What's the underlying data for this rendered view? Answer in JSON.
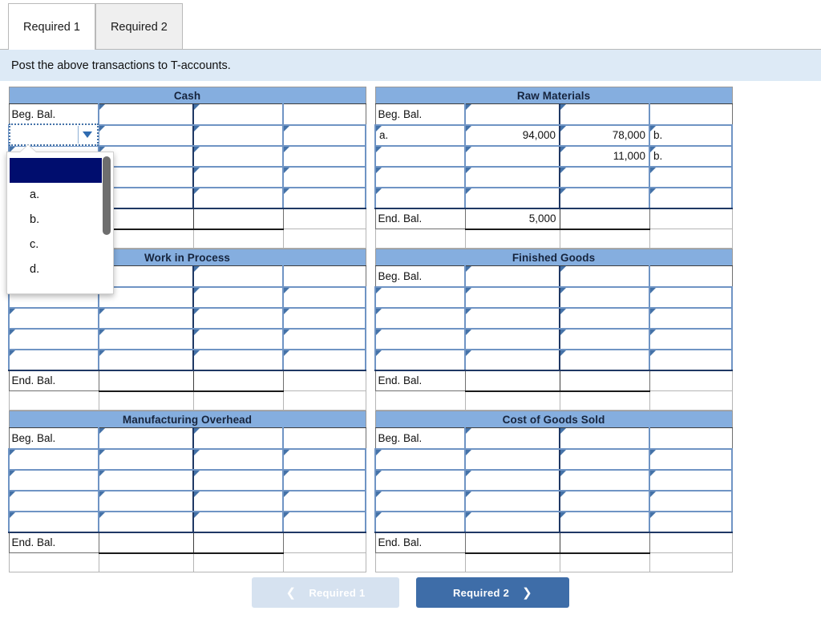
{
  "tabs": [
    {
      "label": "Required 1",
      "active": true
    },
    {
      "label": "Required 2",
      "active": false
    }
  ],
  "instruction": "Post the above transactions to T-accounts.",
  "labels": {
    "beg_bal": "Beg. Bal.",
    "end_bal": "End. Bal."
  },
  "dropdown": {
    "selected_value": "",
    "open": true,
    "options": [
      "",
      "a.",
      "b.",
      "c.",
      "d."
    ]
  },
  "accounts": [
    {
      "title": "Cash",
      "position": "left",
      "rows": [
        {
          "left_label": "Beg. Bal.",
          "debit": "",
          "credit": "",
          "right_label": ""
        },
        {
          "left_label": "",
          "debit": "",
          "credit": "",
          "right_label": ""
        },
        {
          "left_label": "",
          "debit": "",
          "credit": "",
          "right_label": ""
        },
        {
          "left_label": "",
          "debit": "",
          "credit": "",
          "right_label": ""
        },
        {
          "left_label": "",
          "debit": "",
          "credit": "",
          "right_label": ""
        }
      ],
      "end_bal": {
        "label": "End. Bal.",
        "value": ""
      }
    },
    {
      "title": "Raw Materials",
      "position": "right",
      "rows": [
        {
          "left_label": "Beg. Bal.",
          "debit": "",
          "credit": "",
          "right_label": ""
        },
        {
          "left_label": "a.",
          "debit": "94,000",
          "credit": "78,000",
          "right_label": "b."
        },
        {
          "left_label": "",
          "debit": "",
          "credit": "11,000",
          "right_label": "b."
        },
        {
          "left_label": "",
          "debit": "",
          "credit": "",
          "right_label": ""
        },
        {
          "left_label": "",
          "debit": "",
          "credit": "",
          "right_label": ""
        }
      ],
      "end_bal": {
        "label": "End. Bal.",
        "value": "5,000"
      }
    },
    {
      "title": "Work in Process",
      "position": "left",
      "rows": [
        {
          "left_label": "Beg. Bal.",
          "debit": "",
          "credit": "",
          "right_label": ""
        },
        {
          "left_label": "",
          "debit": "",
          "credit": "",
          "right_label": ""
        },
        {
          "left_label": "",
          "debit": "",
          "credit": "",
          "right_label": ""
        },
        {
          "left_label": "",
          "debit": "",
          "credit": "",
          "right_label": ""
        },
        {
          "left_label": "",
          "debit": "",
          "credit": "",
          "right_label": ""
        }
      ],
      "end_bal": {
        "label": "End. Bal.",
        "value": ""
      }
    },
    {
      "title": "Finished Goods",
      "position": "right",
      "rows": [
        {
          "left_label": "Beg. Bal.",
          "debit": "",
          "credit": "",
          "right_label": ""
        },
        {
          "left_label": "",
          "debit": "",
          "credit": "",
          "right_label": ""
        },
        {
          "left_label": "",
          "debit": "",
          "credit": "",
          "right_label": ""
        },
        {
          "left_label": "",
          "debit": "",
          "credit": "",
          "right_label": ""
        },
        {
          "left_label": "",
          "debit": "",
          "credit": "",
          "right_label": ""
        }
      ],
      "end_bal": {
        "label": "End. Bal.",
        "value": ""
      }
    },
    {
      "title": "Manufacturing Overhead",
      "position": "left",
      "rows": [
        {
          "left_label": "Beg. Bal.",
          "debit": "",
          "credit": "",
          "right_label": ""
        },
        {
          "left_label": "",
          "debit": "",
          "credit": "",
          "right_label": ""
        },
        {
          "left_label": "",
          "debit": "",
          "credit": "",
          "right_label": ""
        },
        {
          "left_label": "",
          "debit": "",
          "credit": "",
          "right_label": ""
        },
        {
          "left_label": "",
          "debit": "",
          "credit": "",
          "right_label": ""
        }
      ],
      "end_bal": {
        "label": "End. Bal.",
        "value": ""
      }
    },
    {
      "title": "Cost of Goods Sold",
      "position": "right",
      "rows": [
        {
          "left_label": "Beg. Bal.",
          "debit": "",
          "credit": "",
          "right_label": ""
        },
        {
          "left_label": "",
          "debit": "",
          "credit": "",
          "right_label": ""
        },
        {
          "left_label": "",
          "debit": "",
          "credit": "",
          "right_label": ""
        },
        {
          "left_label": "",
          "debit": "",
          "credit": "",
          "right_label": ""
        },
        {
          "left_label": "",
          "debit": "",
          "credit": "",
          "right_label": ""
        }
      ],
      "end_bal": {
        "label": "End. Bal.",
        "value": ""
      }
    }
  ],
  "footer": {
    "prev_label": "Required 1",
    "prev_icon": "chevron-left-icon",
    "next_label": "Required 2",
    "next_icon": "chevron-right-icon"
  },
  "colors": {
    "header_blue": "#85aedf",
    "banner_blue": "#ddeaf6",
    "accent_blue": "#3e6da8",
    "prev_btn": "#d6e2f0",
    "select_navy": "#000d6e"
  }
}
